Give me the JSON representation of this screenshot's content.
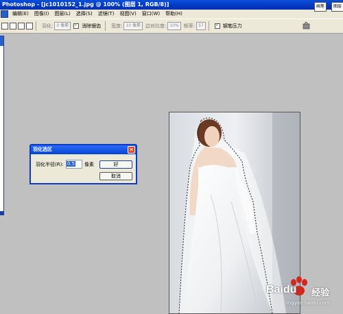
{
  "app": {
    "title": "Photoshop - [jc1010152_1.jpg @ 100% (图层 1, RGB/8)]"
  },
  "menubar": {
    "items": [
      "编辑(E)",
      "图像(I)",
      "图层(L)",
      "选择(S)",
      "滤镜(T)",
      "视图(V)",
      "窗口(W)",
      "帮助(H)"
    ]
  },
  "options": {
    "feather_label": "羽化:",
    "feather_value": "0 像素",
    "antialias_label": "消除锯齿",
    "antialias_checked": true,
    "width_label": "宽度:",
    "width_value": "10 像素",
    "contrast_label": "边对比度:",
    "contrast_value": "10%",
    "frequency_label": "频率:",
    "frequency_value": "57",
    "pen_pressure_label": "钢笔压力",
    "pen_pressure_checked": true,
    "palette_btn_1": "画笔",
    "palette_btn_2": "图层"
  },
  "dialog": {
    "title": "羽化选区",
    "radius_label": "羽化半径(R):",
    "radius_value": "0.5",
    "unit": "像素",
    "ok_label": "好",
    "cancel_label": "取消"
  },
  "watermark": {
    "brand": "Baidu",
    "product": "经验",
    "url": "jingyan.baidu.com"
  },
  "colors": {
    "titlebar_blue": "#0338c2",
    "canvas_gray": "#c0c0c0",
    "chrome": "#ece9d8",
    "close_red": "#e04a2a",
    "baidu_red": "#d0271f"
  }
}
